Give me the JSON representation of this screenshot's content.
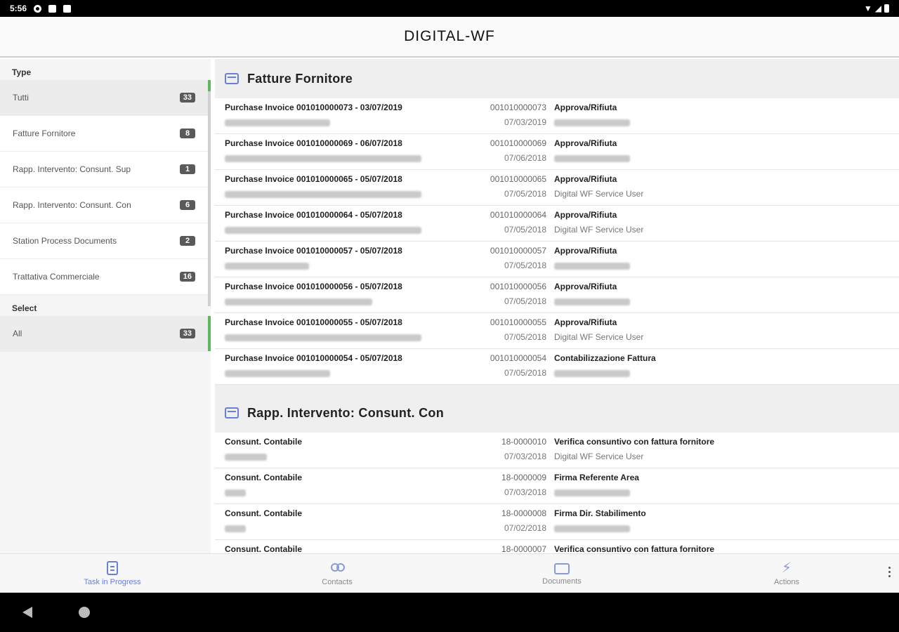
{
  "status_bar": {
    "time": "5:56"
  },
  "app": {
    "title": "DIGITAL-WF"
  },
  "sidebar": {
    "type_label": "Type",
    "type_items": [
      {
        "label": "Tutti",
        "count": "33",
        "selected": true
      },
      {
        "label": "Fatture Fornitore",
        "count": "8"
      },
      {
        "label": "Rapp. Intervento: Consunt. Sup",
        "count": "1"
      },
      {
        "label": "Rapp. Intervento: Consunt. Con",
        "count": "6"
      },
      {
        "label": "Station Process Documents",
        "count": "2"
      },
      {
        "label": "Trattativa Commerciale",
        "count": "16"
      }
    ],
    "select_label": "Select",
    "select_items": [
      {
        "label": "All",
        "count": "33",
        "selected": true
      }
    ]
  },
  "groups": [
    {
      "title": "Fatture Fornitore",
      "rows": [
        {
          "title": "Purchase Invoice 001010000073 - 03/07/2019",
          "number": "001010000073",
          "date": "07/03/2019",
          "action": "Approva/Rifiuta",
          "user": ""
        },
        {
          "title": "Purchase Invoice 001010000069 - 06/07/2018",
          "number": "001010000069",
          "date": "07/06/2018",
          "action": "Approva/Rifiuta",
          "user": ""
        },
        {
          "title": "Purchase Invoice 001010000065 - 05/07/2018",
          "number": "001010000065",
          "date": "07/05/2018",
          "action": "Approva/Rifiuta",
          "user": "Digital WF Service User"
        },
        {
          "title": "Purchase Invoice 001010000064 - 05/07/2018",
          "number": "001010000064",
          "date": "07/05/2018",
          "action": "Approva/Rifiuta",
          "user": "Digital WF Service User"
        },
        {
          "title": "Purchase Invoice 001010000057 - 05/07/2018",
          "number": "001010000057",
          "date": "07/05/2018",
          "action": "Approva/Rifiuta",
          "user": ""
        },
        {
          "title": "Purchase Invoice 001010000056 - 05/07/2018",
          "number": "001010000056",
          "date": "07/05/2018",
          "action": "Approva/Rifiuta",
          "user": ""
        },
        {
          "title": "Purchase Invoice 001010000055 - 05/07/2018",
          "number": "001010000055",
          "date": "07/05/2018",
          "action": "Approva/Rifiuta",
          "user": "Digital WF Service User"
        },
        {
          "title": "Purchase Invoice 001010000054 - 05/07/2018",
          "number": "001010000054",
          "date": "07/05/2018",
          "action": "Contabilizzazione Fattura",
          "user": ""
        }
      ]
    },
    {
      "title": "Rapp. Intervento: Consunt. Con",
      "rows": [
        {
          "title": "Consunt. Contabile",
          "number": "18-0000010",
          "date": "07/03/2018",
          "action": "Verifica consuntivo con fattura fornitore",
          "user": "Digital WF Service User"
        },
        {
          "title": "Consunt. Contabile",
          "number": "18-0000009",
          "date": "07/03/2018",
          "action": "Firma Referente Area",
          "user": ""
        },
        {
          "title": "Consunt. Contabile",
          "number": "18-0000008",
          "date": "07/02/2018",
          "action": "Firma Dir. Stabilimento",
          "user": ""
        },
        {
          "title": "Consunt. Contabile",
          "number": "18-0000007",
          "date": "",
          "action": "Verifica consuntivo con fattura fornitore",
          "user": ""
        }
      ]
    }
  ],
  "bottom_nav": [
    {
      "label": "Task in Progress",
      "icon": "task-icon",
      "active": true
    },
    {
      "label": "Contacts",
      "icon": "contacts-icon"
    },
    {
      "label": "Documents",
      "icon": "documents-icon"
    },
    {
      "label": "Actions",
      "icon": "actions-icon"
    }
  ],
  "colors": {
    "accent": "#6a7fd8",
    "selection_bar": "#5cb85c",
    "badge": "#5a5a5a"
  }
}
